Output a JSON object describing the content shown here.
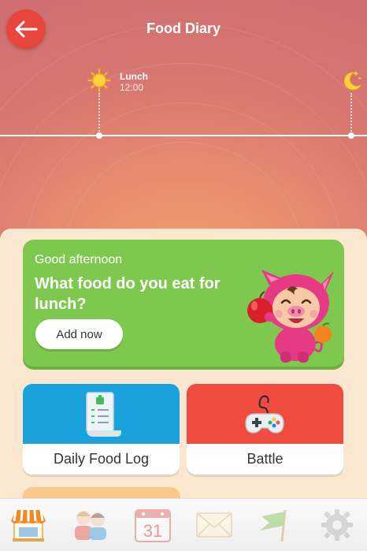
{
  "header": {
    "title": "Food Diary",
    "back_icon": "back-arrow-icon"
  },
  "timeline": {
    "current_meal": {
      "label": "Lunch",
      "time": "12:00",
      "icon": "sun-icon"
    },
    "next_icon": "moon-icon"
  },
  "promo": {
    "greeting": "Good afternoon",
    "question": "What food do you eat for lunch?",
    "button_label": "Add now",
    "mascot": "pig-mascot-with-apple-and-orange",
    "color": "#7ec850"
  },
  "cards": [
    {
      "label": "Daily Food Log",
      "icon": "food-log-document-icon",
      "color": "#1aa2dd"
    },
    {
      "label": "Battle",
      "icon": "gamepad-icon",
      "color": "#f04b3f"
    }
  ],
  "tabbar": {
    "items": [
      {
        "name": "shop",
        "icon": "shop-icon",
        "active": true
      },
      {
        "name": "friends",
        "icon": "friends-icon",
        "active": false
      },
      {
        "name": "calendar",
        "icon": "calendar-icon",
        "text": "31",
        "active": false
      },
      {
        "name": "mail",
        "icon": "mail-icon",
        "active": false
      },
      {
        "name": "flag",
        "icon": "flag-icon",
        "active": false
      },
      {
        "name": "settings",
        "icon": "gear-icon",
        "active": false
      }
    ]
  }
}
